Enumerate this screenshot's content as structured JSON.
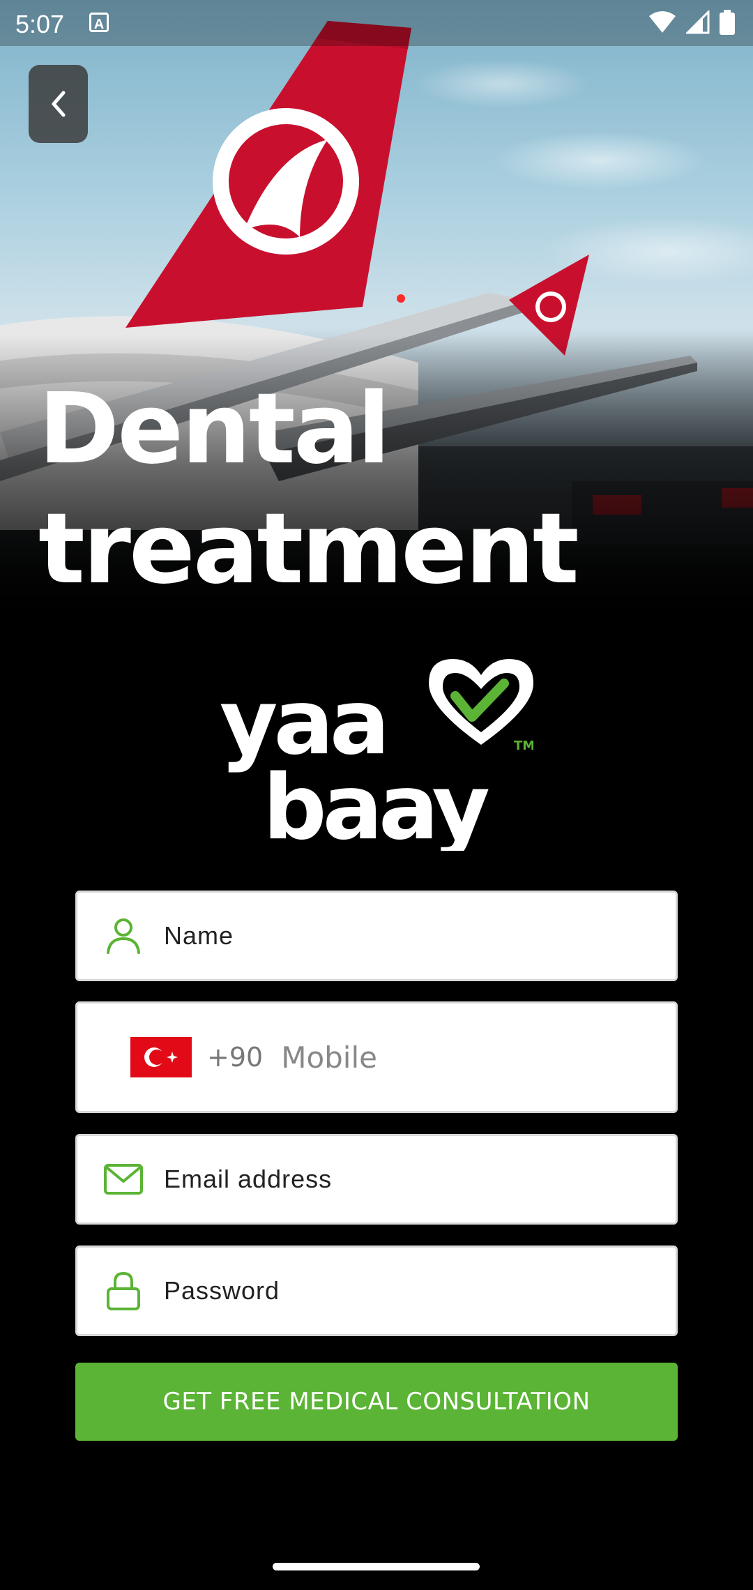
{
  "status_bar": {
    "time": "5:07",
    "notification_icon": "A"
  },
  "hero": {
    "title_line1": "Dental",
    "title_line2": "treatment"
  },
  "logo": {
    "line1": "yaa",
    "line2": "baay",
    "trademark": "TM"
  },
  "form": {
    "name_placeholder": "Name",
    "phone_country_code": "+90",
    "phone_placeholder": "Mobile",
    "email_placeholder": "Email address",
    "password_placeholder": "Password",
    "submit_label": "GET FREE MEDICAL CONSULTATION"
  },
  "colors": {
    "accent": "#5bb435",
    "flag_red": "#e30a17",
    "plane_red": "#c8102e"
  },
  "icons": {
    "back": "chevron-left-icon",
    "name": "person-icon",
    "email": "mail-icon",
    "password": "lock-icon"
  }
}
